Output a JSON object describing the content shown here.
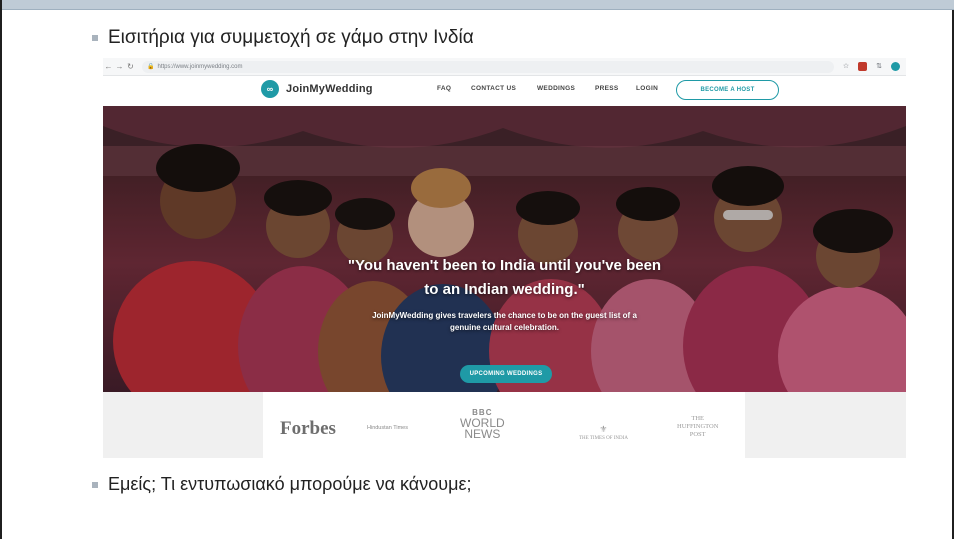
{
  "slide": {
    "bullet_1": "Εισιτήρια για συμμετοχή σε γάμο στην Ινδία",
    "bullet_2": "Εμείς; Τι εντυπωσιακό μπορούμε να κάνουμε;"
  },
  "browser": {
    "url": "https://www.joinmywedding.com",
    "nav_icons": [
      "back-icon",
      "forward-icon",
      "reload-icon"
    ]
  },
  "site": {
    "logo_text": "JoinMyWedding",
    "menu": [
      "FAQ",
      "CONTACT US",
      "WEDDINGS",
      "PRESS",
      "LOGIN"
    ],
    "cta": "BECOME A HOST",
    "hero": {
      "quote_line_1": "\"You haven't been to India until you've been",
      "quote_line_2": "to an Indian wedding.\"",
      "sub_line_1": "JoinMyWedding gives travelers the chance to be on the guest list of a",
      "sub_line_2": "genuine cultural celebration.",
      "button": "UPCOMING WEDDINGS"
    },
    "press": {
      "forbes": "Forbes",
      "hindustan_times": "Hindustan Times",
      "bbc_boxes": "BBC",
      "bbc_line_1": "WORLD",
      "bbc_line_2": "NEWS",
      "toi": "THE TIMES OF INDIA",
      "huff_1": "THE",
      "huff_2": "HUFFINGTON",
      "huff_3": "POST"
    }
  },
  "colors": {
    "accent": "#1f9aa6",
    "slide_bar": "#bfcbd6"
  }
}
